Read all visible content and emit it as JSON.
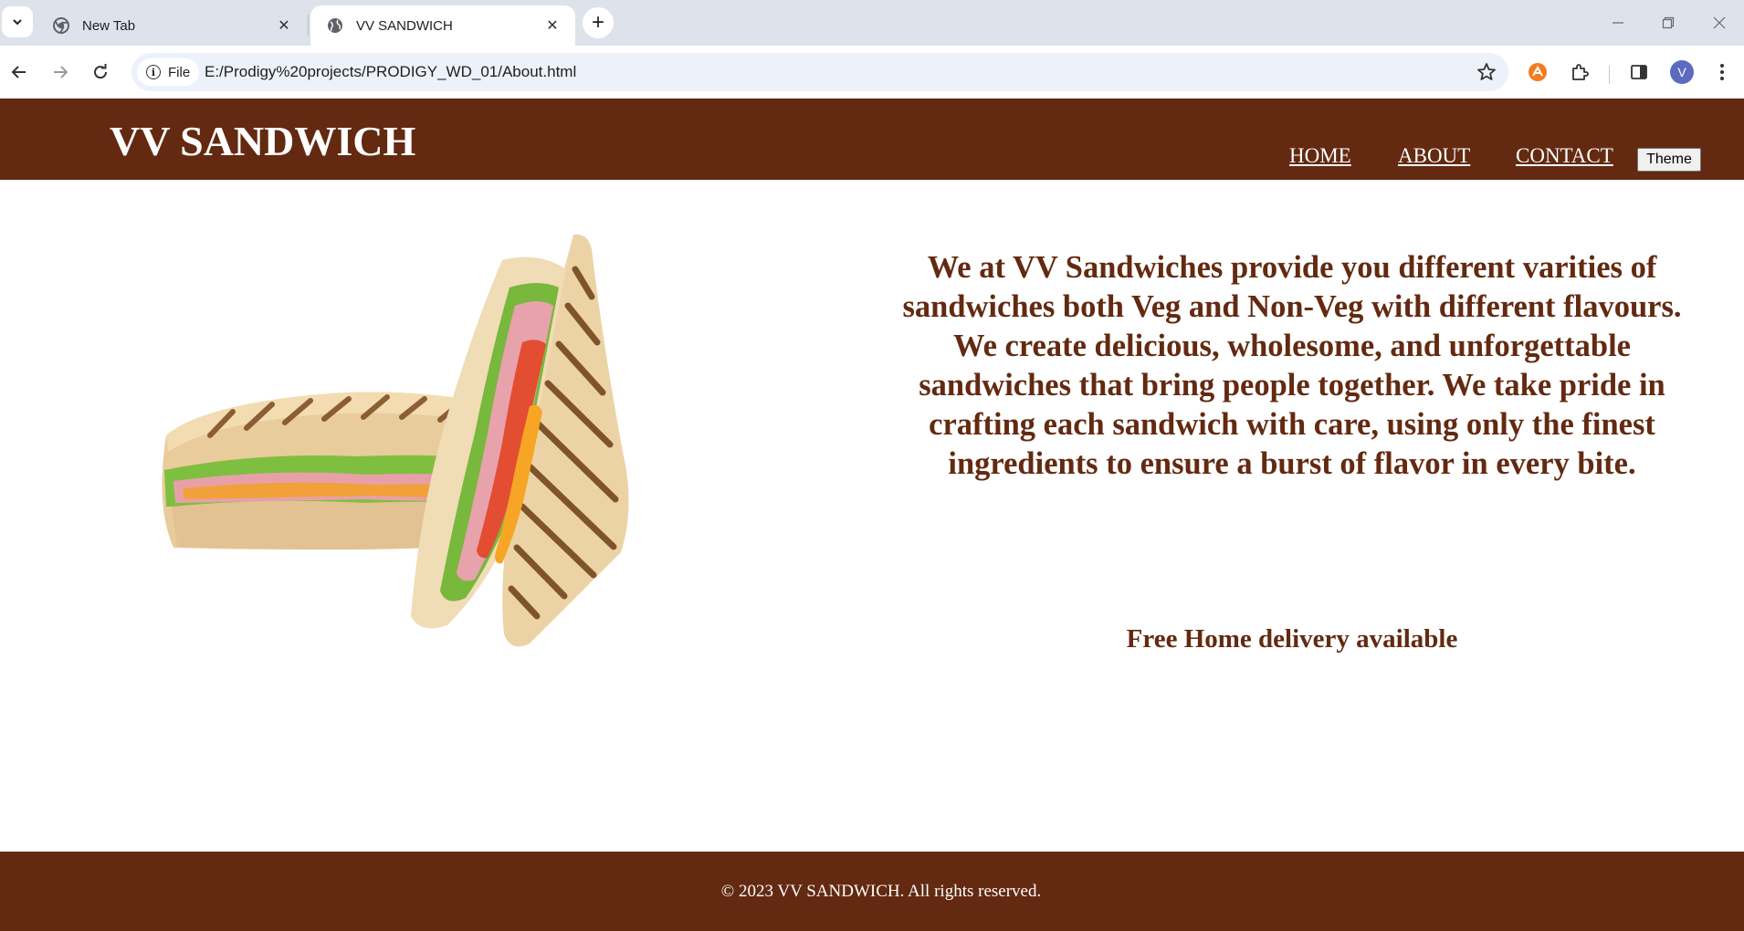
{
  "browser": {
    "tabs": [
      {
        "title": "New Tab",
        "icon": "chrome-icon",
        "active": false
      },
      {
        "title": "VV SANDWICH",
        "icon": "globe-icon",
        "active": true
      }
    ],
    "address": {
      "scheme_chip": "File",
      "url": "E:/Prodigy%20projects/PRODIGY_WD_01/About.html"
    },
    "profile_initial": "V"
  },
  "header": {
    "logo": "VV SANDWICH",
    "nav": [
      "HOME",
      "ABOUT",
      "CONTACT"
    ],
    "theme_button": "Theme"
  },
  "main": {
    "image_alt": "sandwich-image",
    "about_text": "We at VV Sandwiches provide you different varities of sandwiches both Veg and Non-Veg with different flavours. We create delicious, wholesome, and unforgettable sandwiches that bring people together. We take pride in crafting each sandwich with care, using only the finest ingredients to ensure a burst of flavor in every bite.",
    "delivery": "Free Home delivery available"
  },
  "footer": {
    "copyright": "© 2023 VV SANDWICH. All rights reserved."
  },
  "colors": {
    "brand": "#632a11",
    "chrome_bg": "#dee3eb",
    "omnibox_bg": "#edf2fa"
  }
}
